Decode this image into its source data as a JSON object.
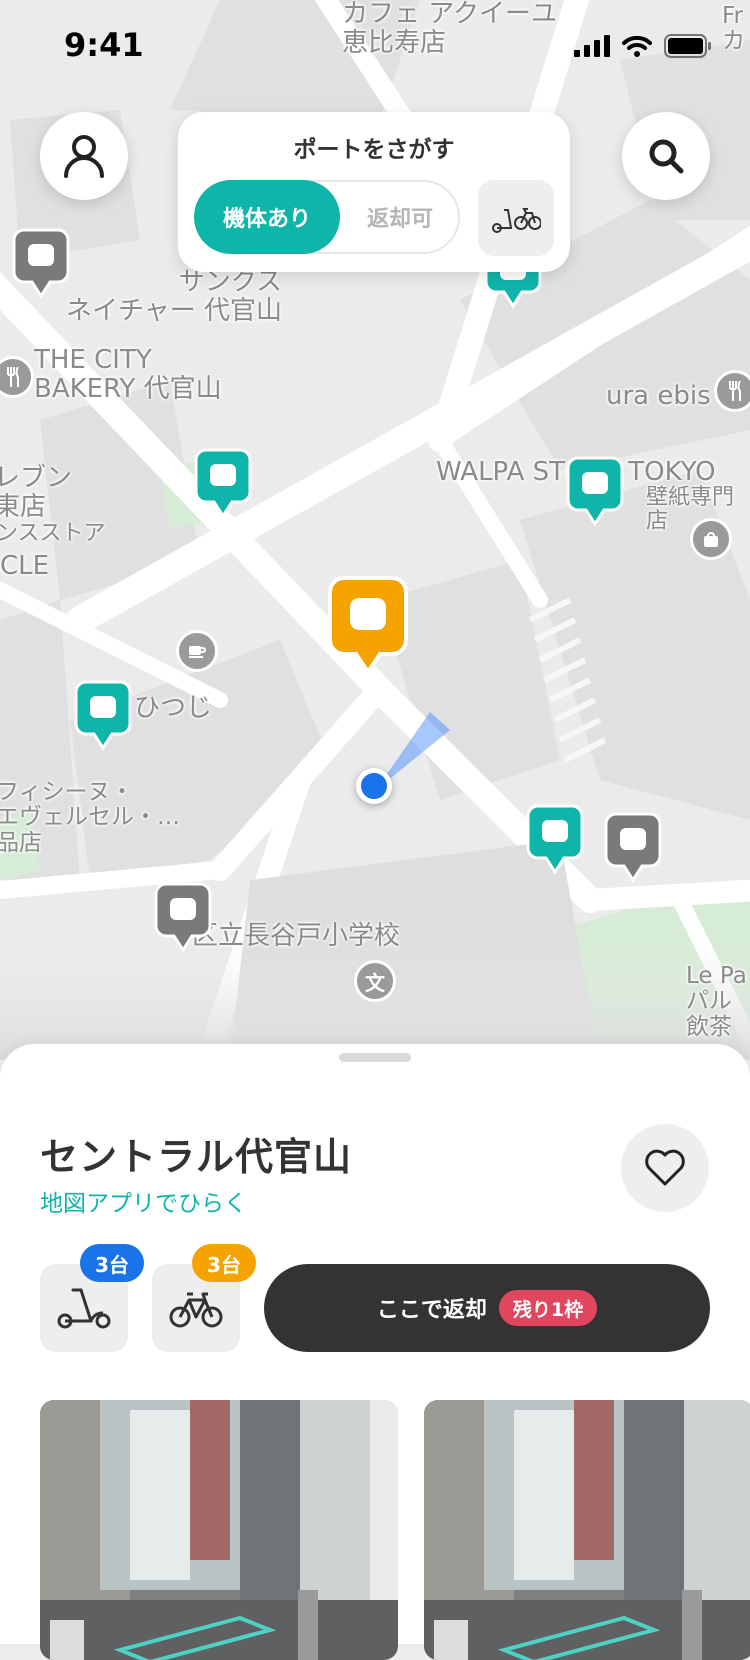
{
  "status_bar": {
    "time": "9:41"
  },
  "map": {
    "labels": [
      {
        "key": "cafe",
        "text": "カフェ アクイーユ\n恵比寿店"
      },
      {
        "key": "sunkus",
        "text": "サンクス\nネイチャー 代官山"
      },
      {
        "key": "citybakery",
        "text": "THE CITY\nBAKERY 代官山"
      },
      {
        "key": "uraebis",
        "text": "ura ebis"
      },
      {
        "key": "walpa",
        "text": "WALPA STORE TOKYO"
      },
      {
        "key": "wallpaper",
        "text": "壁紙専門店"
      },
      {
        "key": "eleven",
        "text": "レブン\n東店"
      },
      {
        "key": "store",
        "text": "ンスストア"
      },
      {
        "key": "cle",
        "text": "CLE"
      },
      {
        "key": "hitsuji",
        "text": "ひつじ"
      },
      {
        "key": "fici",
        "text": "フィシーヌ・\nエヴェルセル・…\n品店"
      },
      {
        "key": "school",
        "text": "区立長谷戸小学校"
      },
      {
        "key": "lepa",
        "text": "Le Pa\nパル\n飲茶"
      },
      {
        "key": "fr",
        "text": "Fr\nカ"
      }
    ],
    "school_icon_text": "文"
  },
  "top_controls": {
    "profile_icon": "person-icon",
    "search_icon": "search-icon",
    "card_title": "ポートをさがす",
    "segment_available": "機体あり",
    "segment_return": "返却可",
    "bike_filter_icon": "scooter-bike-icon"
  },
  "sheet": {
    "port_name": "セントラル代官山",
    "map_link": "地図アプリでひらく",
    "scooter_count": "3台",
    "bike_count": "3台",
    "return_label": "ここで返却",
    "remaining_label": "残り1枠"
  },
  "colors": {
    "accent": "#10b5a9",
    "selected_pin": "#f4a300",
    "gray_pin": "#7a7a7a",
    "scooter_badge": "#1a73e8",
    "bike_badge": "#f4a300",
    "remaining_badge": "#e0465d",
    "dark_button": "#333333"
  }
}
